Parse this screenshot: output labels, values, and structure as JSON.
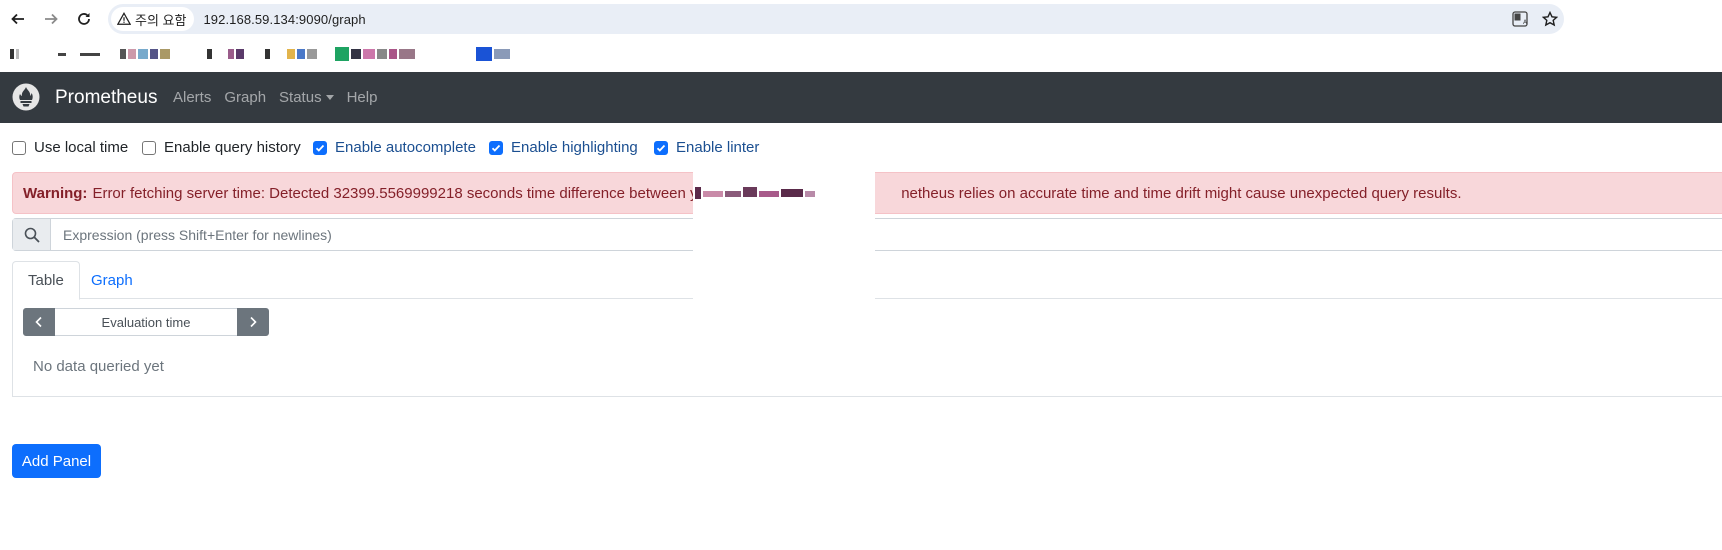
{
  "browser": {
    "security_chip": "주의 요함",
    "url": "192.168.59.134:9090/graph"
  },
  "app": {
    "brand": "Prometheus",
    "nav": [
      "Alerts",
      "Graph",
      "Status",
      "Help"
    ]
  },
  "settings": [
    {
      "label": "Use local time",
      "checked": false
    },
    {
      "label": "Enable query history",
      "checked": false
    },
    {
      "label": "Enable autocomplete",
      "checked": true
    },
    {
      "label": "Enable highlighting",
      "checked": true
    },
    {
      "label": "Enable linter",
      "checked": true
    }
  ],
  "warning": {
    "strong": "Warning:",
    "text_before": "Error fetching server time: Detected 32399.5569999218 seconds time difference between your",
    "text_after": "netheus relies on accurate time and time drift might cause unexpected query results."
  },
  "expression": {
    "placeholder": "Expression (press Shift+Enter for newlines)",
    "value": ""
  },
  "tabs": [
    "Table",
    "Graph"
  ],
  "evaluation": {
    "placeholder": "Evaluation time"
  },
  "no_data": "No data queried yet",
  "add_panel": "Add Panel"
}
